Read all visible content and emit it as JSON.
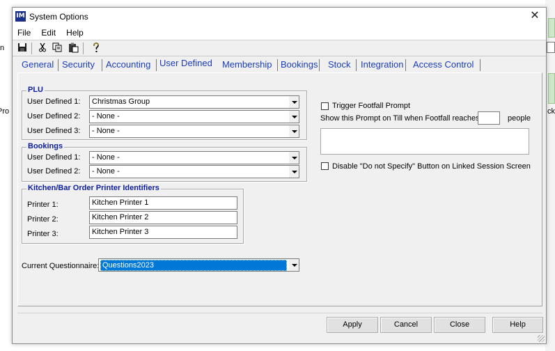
{
  "window": {
    "title": "System Options",
    "app_icon_text": "IM"
  },
  "menu": [
    "File",
    "Edit",
    "Help"
  ],
  "toolbar": {
    "items": [
      "save-icon",
      "cut-icon",
      "copy-icon",
      "paste-icon",
      "help-icon"
    ]
  },
  "tabs": [
    "General",
    "Security",
    "Accounting",
    "User Defined",
    "Membership",
    "Bookings",
    "Stock",
    "Integration",
    "Access Control"
  ],
  "active_tab": "User Defined",
  "plu": {
    "title": "PLU",
    "rows": [
      {
        "label": "User Defined 1:",
        "value": "Christmas Group"
      },
      {
        "label": "User Defined 2:",
        "value": " - None -"
      },
      {
        "label": "User Defined 3:",
        "value": " - None -"
      }
    ]
  },
  "bookings": {
    "title": "Bookings",
    "rows": [
      {
        "label": "User Defined 1:",
        "value": " - None -"
      },
      {
        "label": "User Defined 2:",
        "value": " - None -"
      }
    ]
  },
  "kitchen": {
    "title": "Kitchen/Bar Order Printer Identifiers",
    "rows": [
      {
        "label": "Printer 1:",
        "value": "Kitchen Printer 1"
      },
      {
        "label": "Printer 2:",
        "value": "Kitchen Printer 2"
      },
      {
        "label": "Printer 3:",
        "value": "Kitchen Printer 3"
      }
    ]
  },
  "questionnaire": {
    "label": "Current Questionnaire:",
    "value": "Questions2023"
  },
  "footfall": {
    "trigger_label": "Trigger Footfall Prompt",
    "trigger_checked": false,
    "show_prompt_label": "Show this Prompt on Till when Footfall reaches",
    "count_value": "",
    "people_label": "people",
    "prompt_text": ""
  },
  "disable_dns": {
    "label": "Disable \"Do not Specify\" Button on  Linked Session Screen",
    "checked": false
  },
  "buttons": {
    "apply": "Apply",
    "cancel": "Cancel",
    "close": "Close",
    "help": "Help"
  },
  "background": {
    "left_text": "Pro",
    "left_text2": "n",
    "right_text": "ck"
  },
  "colors": {
    "group_title": "#0b1d9e",
    "tab_text": "#1a3cba",
    "selection": "#0078d7"
  }
}
